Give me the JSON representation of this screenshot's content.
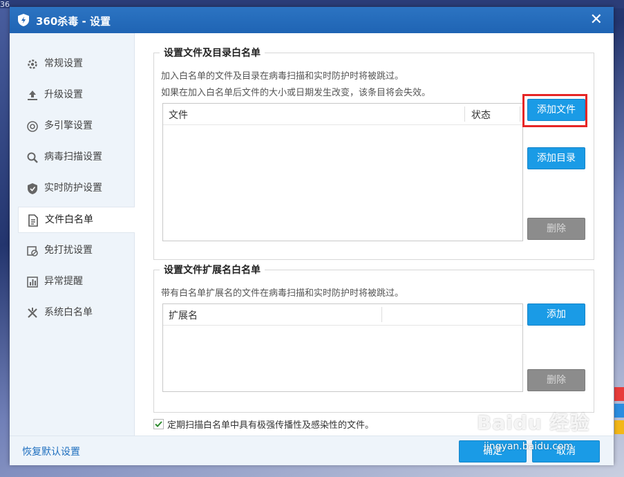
{
  "background": {
    "top_left_text": "36",
    "right_strip_colors": [
      "#e83b3b",
      "#2a8de0",
      "#f3b718"
    ]
  },
  "window": {
    "title": "360杀毒 - 设置",
    "close_glyph": "✕",
    "accent": "#1f64b4"
  },
  "sidebar": {
    "items": [
      {
        "label": "常规设置",
        "icon": "gear-icon"
      },
      {
        "label": "升级设置",
        "icon": "upload-icon"
      },
      {
        "label": "多引擎设置",
        "icon": "engine-icon"
      },
      {
        "label": "病毒扫描设置",
        "icon": "search-icon"
      },
      {
        "label": "实时防护设置",
        "icon": "shield-icon"
      },
      {
        "label": "文件白名单",
        "icon": "document-icon",
        "active": true
      },
      {
        "label": "免打扰设置",
        "icon": "do-not-disturb-icon"
      },
      {
        "label": "异常提醒",
        "icon": "bar-chart-icon"
      },
      {
        "label": "系统白名单",
        "icon": "tools-icon"
      }
    ]
  },
  "file_whitelist": {
    "title": "设置文件及目录白名单",
    "desc_line1": "加入白名单的文件及目录在病毒扫描和实时防护时将被跳过。",
    "desc_line2": "如果在加入白名单后文件的大小或日期发生改变，该条目将会失效。",
    "col_file": "文件",
    "col_status": "状态",
    "add_file_label": "添加文件",
    "add_dir_label": "添加目录",
    "delete_label": "删除"
  },
  "ext_whitelist": {
    "title": "设置文件扩展名白名单",
    "desc": "带有白名单扩展名的文件在病毒扫描和实时防护时将被跳过。",
    "col_ext": "扩展名",
    "add_label": "添加",
    "delete_label": "删除"
  },
  "periodic_scan": {
    "checked": true,
    "label": "定期扫描白名单中具有极强传播性及感染性的文件。"
  },
  "footer": {
    "reset_label": "恢复默认设置",
    "ok_label": "确定",
    "cancel_label": "取消"
  },
  "watermark": {
    "main": "Baidu 经验",
    "sub": "jingyan.baidu.com"
  }
}
